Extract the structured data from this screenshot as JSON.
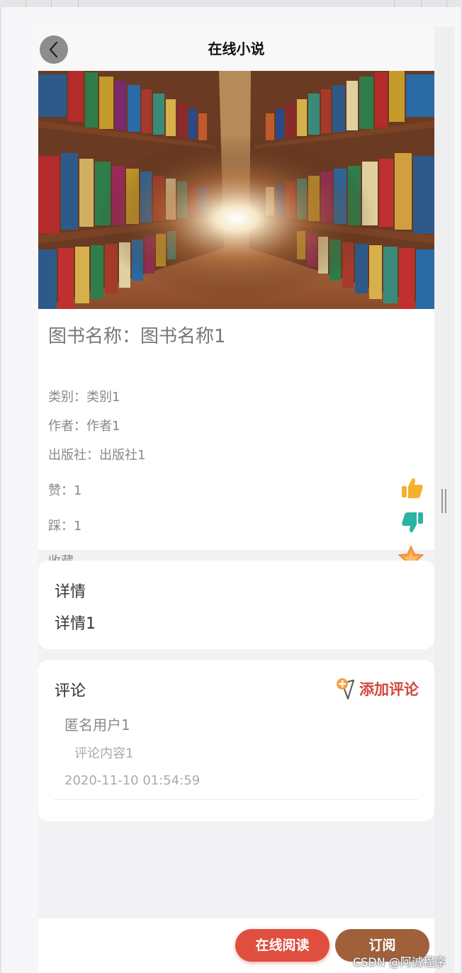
{
  "header": {
    "title": "在线小说",
    "back_icon": "chevron-left-icon"
  },
  "banner": {
    "image_desc": "bookshelf-corridor-photo",
    "active_dot": 1
  },
  "book": {
    "name": "图书名称：图书名称1",
    "category": "类别：类别1",
    "author": "作者：作者1",
    "publisher": "出版社：出版社1",
    "likes": "赞：1",
    "dislikes": "踩：1",
    "favorite": "收藏"
  },
  "detail": {
    "title": "详情",
    "content": "详情1"
  },
  "comments": {
    "title": "评论",
    "add_label": "添加评论",
    "items": [
      {
        "user": "匿名用户1",
        "content": "评论内容1",
        "time": "2020-11-10 01:54:59"
      }
    ]
  },
  "footer": {
    "read_label": "在线阅读",
    "subscribe_label": "订阅"
  },
  "watermark": "CSDN @阿诚程序",
  "colors": {
    "accent_red": "#e04e40",
    "subscribe_brown": "#a0603a",
    "like_yellow": "#f5b02e",
    "dislike_teal": "#2bb3a3",
    "star_orange": "#f6a04d"
  }
}
